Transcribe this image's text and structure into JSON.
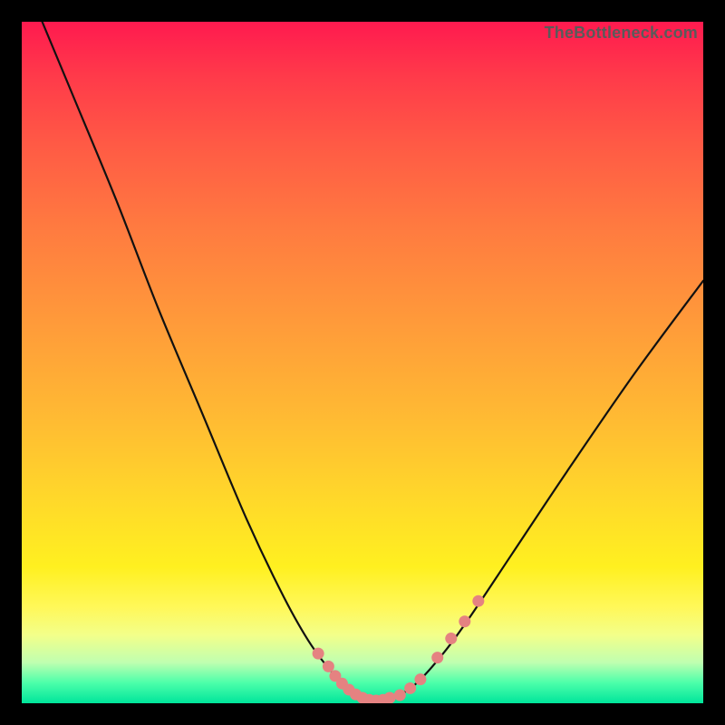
{
  "watermark": {
    "text": "TheBottleneck.com"
  },
  "chart_data": {
    "type": "line",
    "title": "",
    "xlabel": "",
    "ylabel": "",
    "xlim": [
      0,
      100
    ],
    "ylim": [
      0,
      100
    ],
    "grid": false,
    "legend": false,
    "series": [
      {
        "name": "curve",
        "x": [
          3,
          8,
          14,
          20,
          26.5,
          33,
          38.5,
          42.5,
          46,
          48.5,
          50.5,
          52,
          55,
          58,
          62,
          66,
          72,
          80,
          90,
          100
        ],
        "y": [
          100,
          88,
          73.5,
          58,
          42.5,
          27,
          15.5,
          8.5,
          4,
          1.7,
          0.7,
          0.4,
          1,
          3,
          7.5,
          13,
          22,
          34,
          48.5,
          62
        ]
      },
      {
        "name": "markers",
        "x": [
          43.5,
          45,
          46,
          47,
          48,
          49,
          50,
          51,
          52,
          53,
          54,
          55.5,
          57,
          58.5,
          61,
          63,
          65,
          67
        ],
        "y": [
          7.3,
          5.4,
          4,
          2.9,
          2,
          1.3,
          0.8,
          0.5,
          0.4,
          0.5,
          0.8,
          1.2,
          2.2,
          3.5,
          6.7,
          9.5,
          12,
          15
        ]
      }
    ]
  },
  "style": {
    "curve_color": "#111111",
    "curve_width": 2.2,
    "marker_color": "#e58281",
    "marker_radius": 6.5
  }
}
